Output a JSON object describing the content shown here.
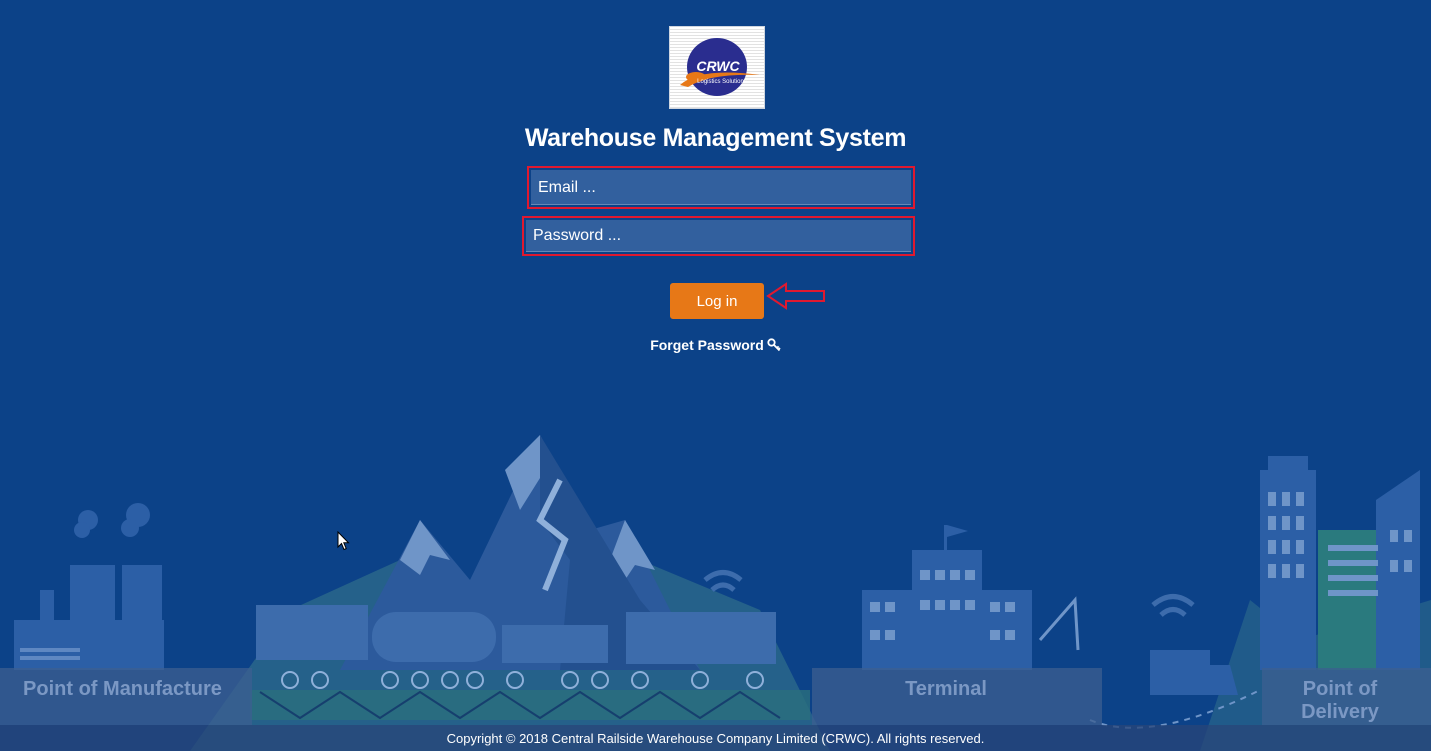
{
  "logo": {
    "brand": "CRWC",
    "tagline": "Logistics Solutions"
  },
  "title": "Warehouse Management System",
  "form": {
    "email_placeholder": "Email ...",
    "password_placeholder": "Password ...",
    "login_label": "Log in",
    "forget_label": "Forget Password"
  },
  "scene": {
    "zones": {
      "manufacture": "Point of Manufacture",
      "terminal": "Terminal",
      "delivery": "Point of Delivery"
    }
  },
  "footer": {
    "copyright": "Copyright © 2018 Central Railside Warehouse Company Limited (CRWC). All rights reserved."
  },
  "colors": {
    "background": "#0c4288",
    "accent_button": "#e77817",
    "highlight_border": "#e0192f",
    "input_fill": "#32609e"
  },
  "icons": [
    "key-icon",
    "left-arrow-annotation-icon",
    "mouse-pointer-icon"
  ]
}
